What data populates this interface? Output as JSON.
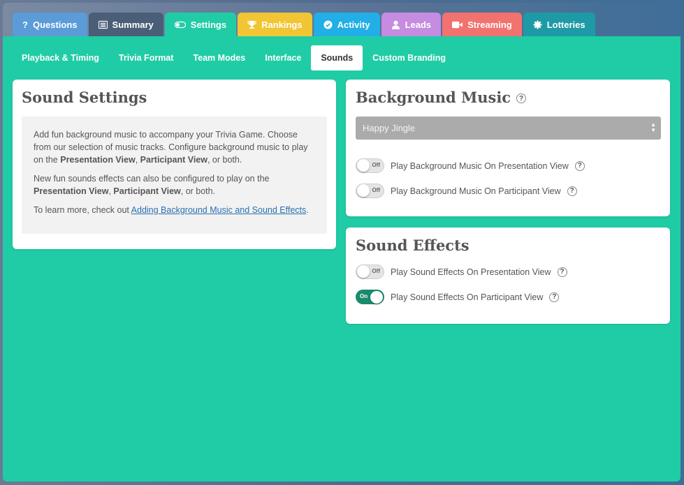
{
  "tabs": [
    {
      "label": "Questions",
      "icon": "question-icon"
    },
    {
      "label": "Summary",
      "icon": "summary-icon"
    },
    {
      "label": "Settings",
      "icon": "toggle-icon"
    },
    {
      "label": "Rankings",
      "icon": "trophy-icon"
    },
    {
      "label": "Activity",
      "icon": "check-circle-icon"
    },
    {
      "label": "Leads",
      "icon": "user-icon"
    },
    {
      "label": "Streaming",
      "icon": "video-icon"
    },
    {
      "label": "Lotteries",
      "icon": "gear-icon"
    }
  ],
  "subtabs": [
    "Playback & Timing",
    "Trivia Format",
    "Team Modes",
    "Interface",
    "Sounds",
    "Custom Branding"
  ],
  "active_subtab": "Sounds",
  "sound_settings": {
    "title": "Sound Settings",
    "p1_pre": "Add fun background music to accompany your Trivia Game. Choose from our selection of music tracks. Configure background music to play on the ",
    "p1_b1": "Presentation View",
    "p1_sep": ", ",
    "p1_b2": "Participant View",
    "p1_post": ", or both.",
    "p2_pre": "New fun sounds effects can also be configured to play on the ",
    "p2_b1": "Presentation View",
    "p2_sep": ", ",
    "p2_b2": "Participant View",
    "p2_post": ", or both.",
    "p3_pre": "To learn more, check out ",
    "p3_link": "Adding Background Music and Sound Effects",
    "p3_post": "."
  },
  "background_music": {
    "title": "Background Music",
    "help": "?",
    "selected_track": "Happy Jingle",
    "options": [
      {
        "label": "Play Background Music On Presentation View",
        "state": "off",
        "state_text": "Off"
      },
      {
        "label": "Play Background Music On Participant View",
        "state": "off",
        "state_text": "Off"
      }
    ]
  },
  "sound_effects": {
    "title": "Sound Effects",
    "options": [
      {
        "label": "Play Sound Effects On Presentation View",
        "state": "off",
        "state_text": "Off"
      },
      {
        "label": "Play Sound Effects On Participant View",
        "state": "on",
        "state_text": "On"
      }
    ]
  },
  "colors": {
    "main_bg": "#20cca6",
    "toggle_on": "#1a8a6e",
    "link": "#2a6fb0"
  }
}
